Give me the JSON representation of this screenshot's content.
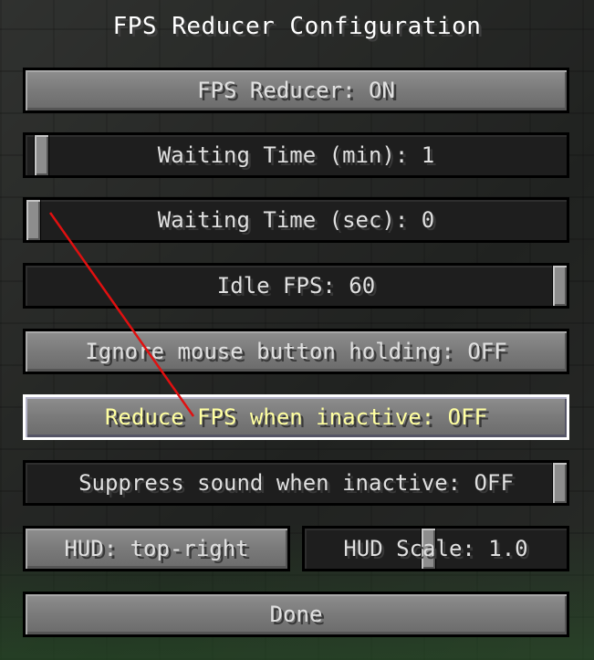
{
  "screen": {
    "title": "FPS Reducer Configuration"
  },
  "options": {
    "fps_reducer": "FPS Reducer: ON",
    "waiting_time_min": {
      "label": "Waiting Time (min): 1",
      "slider_fraction": 0.0
    },
    "waiting_time_sec": {
      "label": "Waiting Time (sec): 0",
      "slider_fraction": 0.0
    },
    "idle_fps": {
      "label": "Idle FPS: 60",
      "slider_fraction": 1.0
    },
    "ignore_mouse": "Ignore mouse button holding: OFF",
    "reduce_inactive": "Reduce FPS when inactive: OFF",
    "suppress_sound": {
      "label": "Suppress sound when inactive: OFF",
      "slider_fraction": 1.0
    },
    "hud_position": "HUD: top-right",
    "hud_scale": {
      "label": "HUD Scale: 1.0",
      "slider_fraction": 0.5
    },
    "done": "Done"
  },
  "colors": {
    "text_default": "#e0e0e0",
    "text_hover": "#ffffa0",
    "annotation_arrow": "#e01010"
  },
  "icons": {
    "annotation": "red-arrow-icon"
  }
}
